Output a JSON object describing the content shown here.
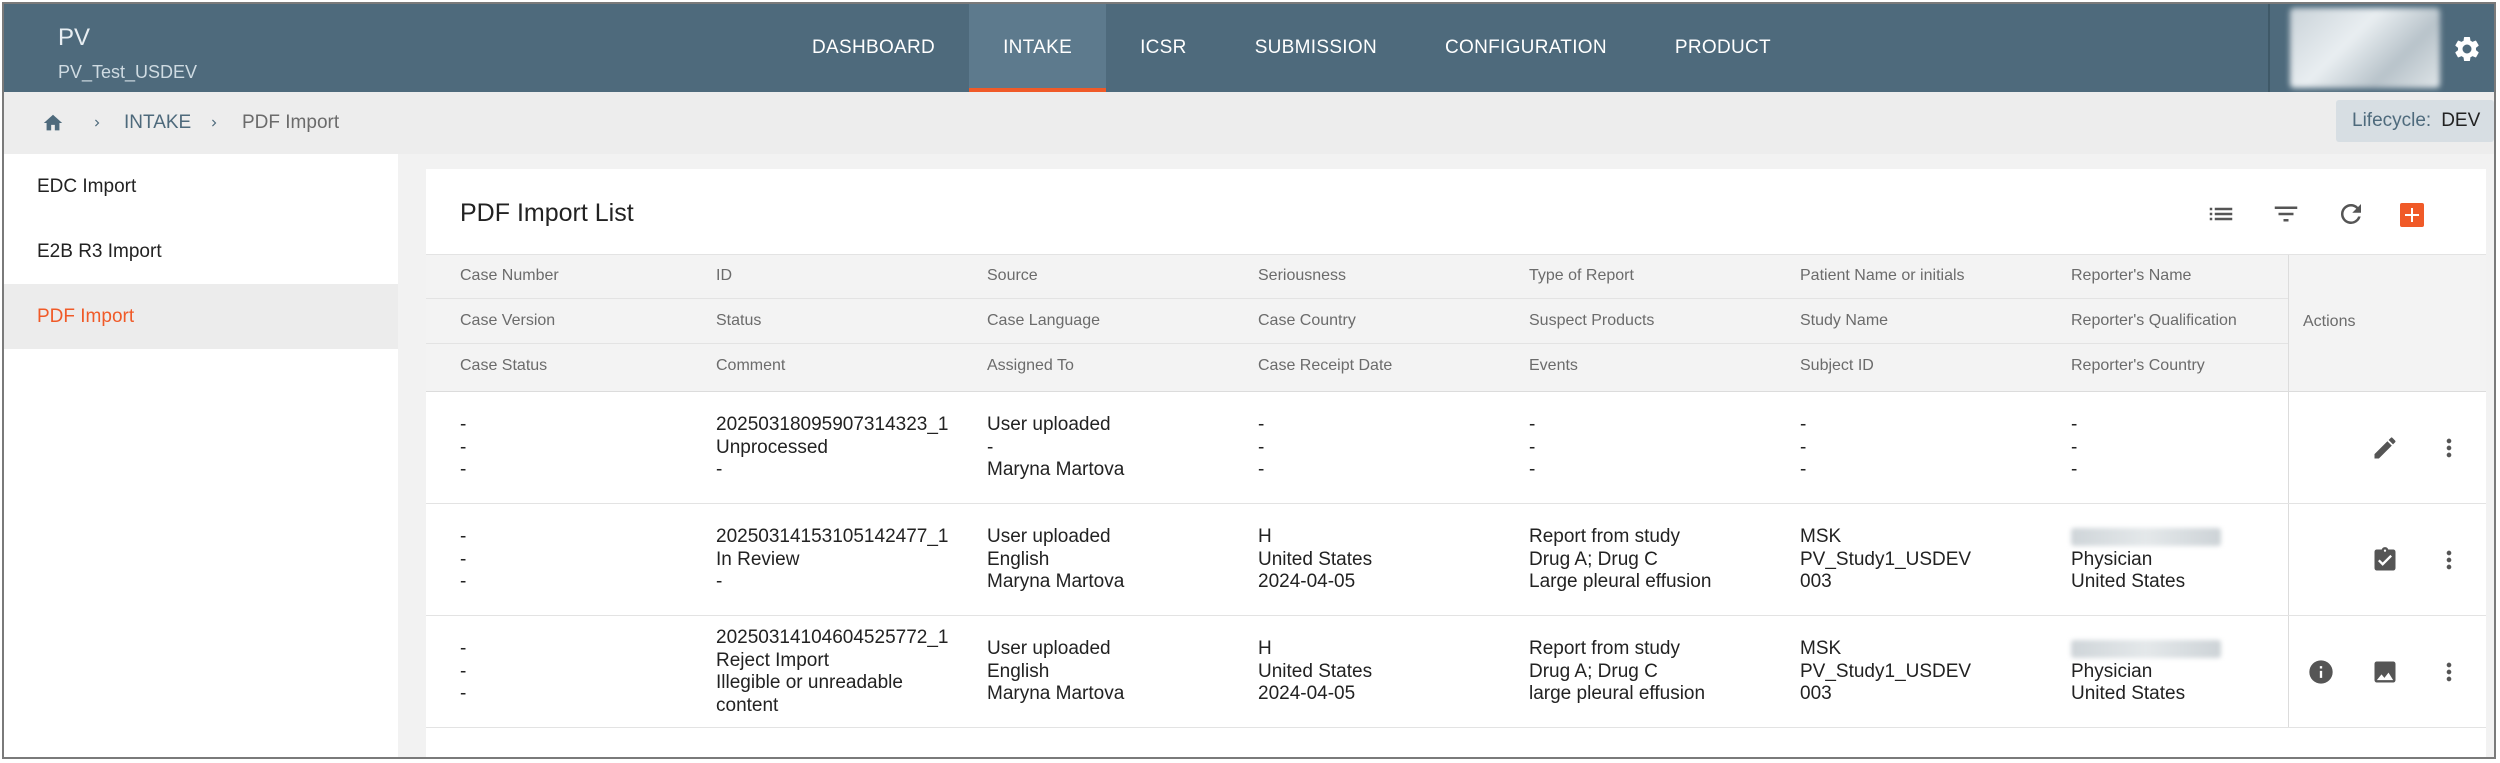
{
  "app": {
    "title": "PV",
    "subtitle": "PV_Test_USDEV"
  },
  "nav": [
    "DASHBOARD",
    "INTAKE",
    "ICSR",
    "SUBMISSION",
    "CONFIGURATION",
    "PRODUCT"
  ],
  "nav_active": "INTAKE",
  "breadcrumb": {
    "section": "INTAKE",
    "current": "PDF Import"
  },
  "lifecycle": {
    "label": "Lifecycle:",
    "value": "DEV"
  },
  "sidebar": {
    "items": [
      "EDC Import",
      "E2B R3 Import",
      "PDF Import"
    ],
    "active": "PDF Import"
  },
  "list": {
    "title": "PDF Import List",
    "toolbar_icons": [
      "list-icon",
      "filter-icon",
      "refresh-icon",
      "add-icon"
    ],
    "header_rows": [
      [
        "Case Number",
        "ID",
        "Source",
        "Seriousness",
        "Type of Report",
        "Patient Name or initials",
        "Reporter's Name"
      ],
      [
        "Case Version",
        "Status",
        "Case Language",
        "Case Country",
        "Suspect Products",
        "Study Name",
        "Reporter's Qualification"
      ],
      [
        "Case Status",
        "Comment",
        "Assigned To",
        "Case Receipt Date",
        "Events",
        "Subject ID",
        "Reporter's Country"
      ]
    ],
    "actions_label": "Actions",
    "rows": [
      {
        "col_case": [
          "-",
          "-",
          "-"
        ],
        "col_id": [
          "20250318095907314323_1",
          "Unprocessed",
          "-"
        ],
        "col_source": [
          "User uploaded",
          "-",
          "Maryna Martova"
        ],
        "col_seriousness": [
          "-",
          "-",
          "-"
        ],
        "col_type": [
          "-",
          "-",
          "-"
        ],
        "col_patient": [
          "-",
          "-",
          "-"
        ],
        "col_reporter": [
          "-",
          "-",
          "-"
        ],
        "actions": [
          "edit-icon",
          "more-vert-icon"
        ]
      },
      {
        "col_case": [
          "-",
          "-",
          "-"
        ],
        "col_id": [
          "20250314153105142477_1",
          "In Review",
          "-"
        ],
        "col_source": [
          "User uploaded",
          "English",
          "Maryna Martova"
        ],
        "col_seriousness": [
          "H",
          "United States",
          "2024-04-05"
        ],
        "col_type": [
          "Report from study",
          "Drug A; Drug C",
          "Large pleural effusion"
        ],
        "col_patient": [
          "MSK",
          "PV_Study1_USDEV",
          "003"
        ],
        "col_reporter": [
          "",
          "Physician",
          "United States"
        ],
        "actions": [
          "clipboard-check-icon",
          "more-vert-icon"
        ]
      },
      {
        "col_case": [
          "-",
          "-",
          "-"
        ],
        "col_id": [
          "20250314104604525772_1",
          "Reject Import",
          "Illegible or unreadable",
          "content"
        ],
        "col_source": [
          "User uploaded",
          "English",
          "Maryna Martova"
        ],
        "col_seriousness": [
          "H",
          "United States",
          "2024-04-05"
        ],
        "col_type": [
          "Report from study",
          "Drug A; Drug C",
          "large pleural effusion"
        ],
        "col_patient": [
          "MSK",
          "PV_Study1_USDEV",
          "003"
        ],
        "col_reporter": [
          "",
          "Physician",
          "United States"
        ],
        "actions": [
          "info-icon",
          "image-icon",
          "more-vert-icon"
        ]
      }
    ]
  },
  "colors": {
    "topbar": "#4e6a7c",
    "accent": "#f05a28",
    "nav_active": "#5d7a8d"
  }
}
